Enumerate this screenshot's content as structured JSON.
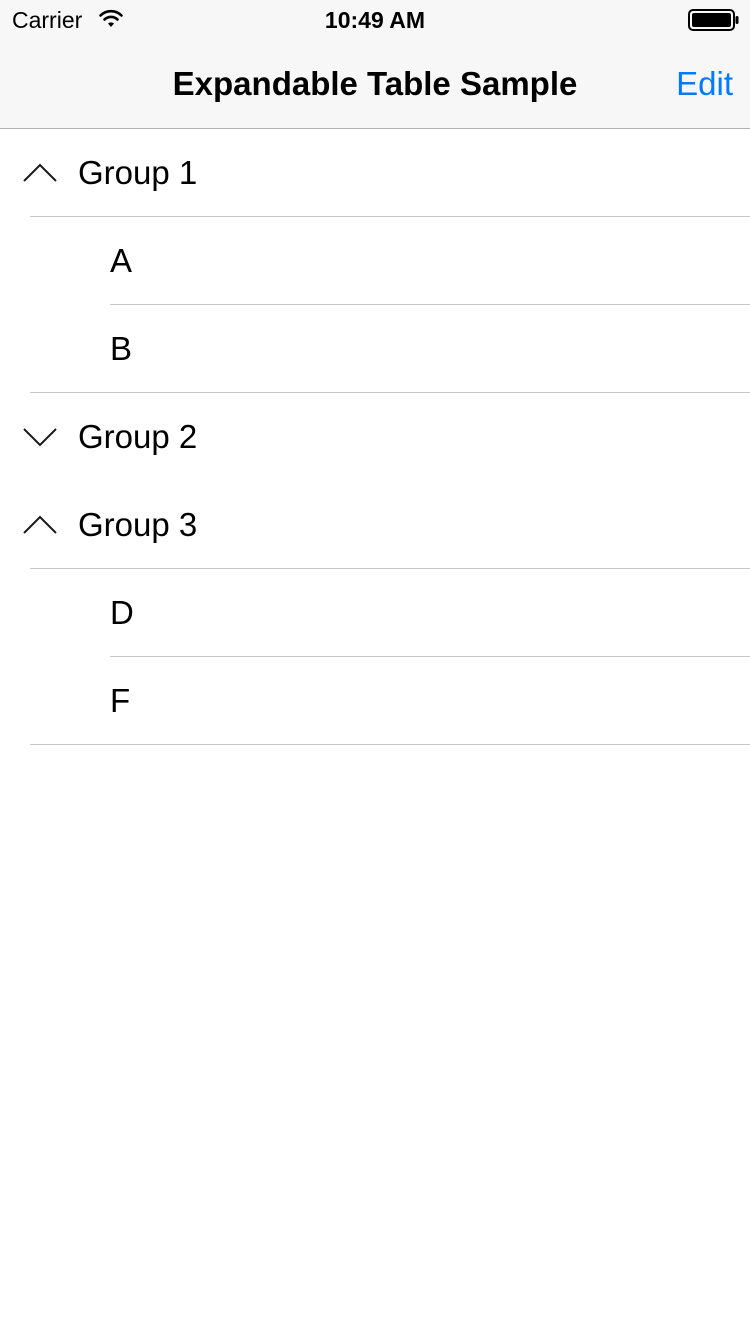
{
  "status_bar": {
    "carrier": "Carrier",
    "time": "10:49 AM",
    "wifi_icon": "wifi-icon",
    "battery_icon": "battery-icon"
  },
  "nav": {
    "title": "Expandable Table Sample",
    "edit_label": "Edit",
    "accent_color": "#007aff"
  },
  "table": {
    "groups": [
      {
        "label": "Group 1",
        "expanded": true,
        "chevron_icon": "chevron-up-icon",
        "children": [
          "A",
          "B"
        ]
      },
      {
        "label": "Group 2",
        "expanded": false,
        "chevron_icon": "chevron-down-icon",
        "children": []
      },
      {
        "label": "Group 3",
        "expanded": true,
        "chevron_icon": "chevron-up-icon",
        "children": [
          "D",
          "F"
        ]
      }
    ]
  }
}
